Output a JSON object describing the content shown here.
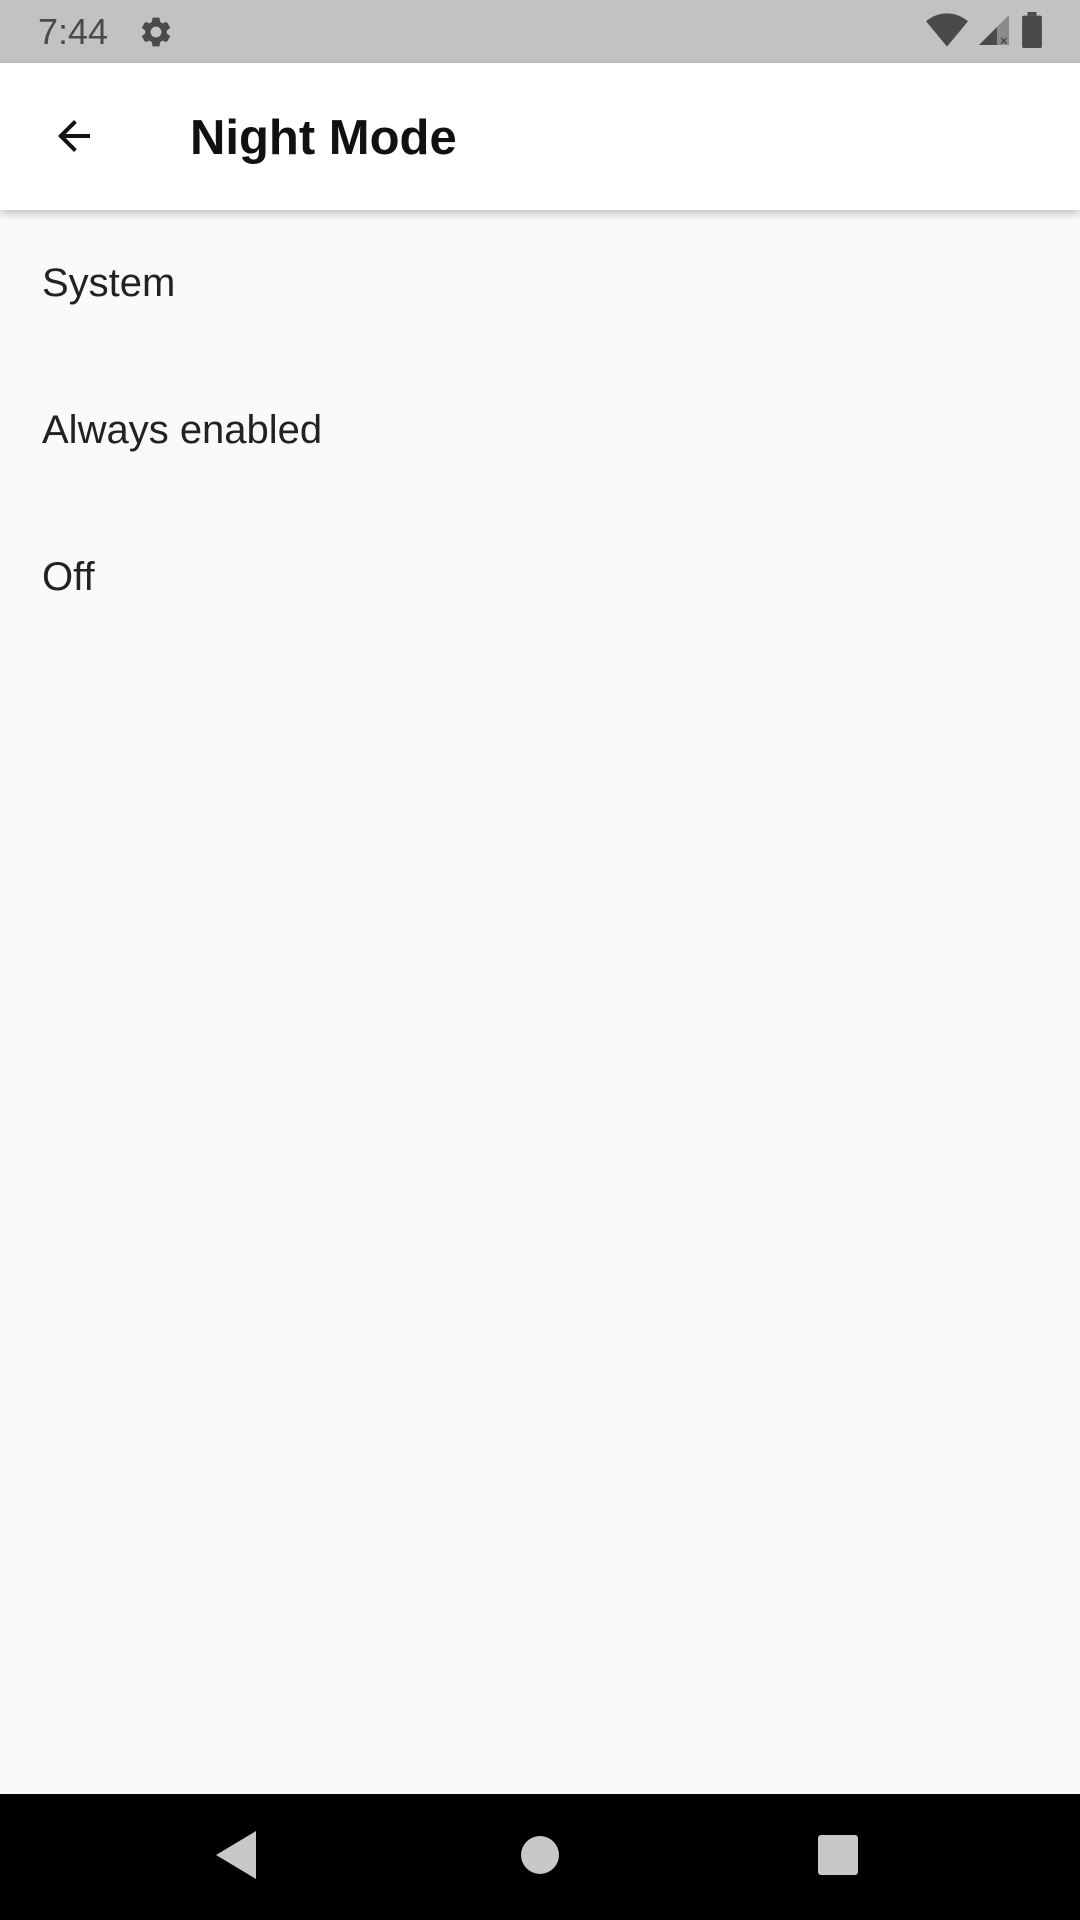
{
  "status_bar": {
    "time": "7:44",
    "icons": [
      "gear-icon",
      "wifi-icon",
      "signal-icon",
      "battery-icon"
    ]
  },
  "app_bar": {
    "title": "Night Mode",
    "back_icon": "arrow-back-icon"
  },
  "options": [
    {
      "label": "System"
    },
    {
      "label": "Always enabled"
    },
    {
      "label": "Off"
    }
  ],
  "nav_bar": {
    "icons": [
      "back-triangle-icon",
      "home-circle-icon",
      "recents-square-icon"
    ]
  },
  "colors": {
    "status_bar_bg": "#c2c2c2",
    "app_bar_bg": "#ffffff",
    "page_bg": "#fafafa",
    "nav_bar_bg": "#000000"
  }
}
